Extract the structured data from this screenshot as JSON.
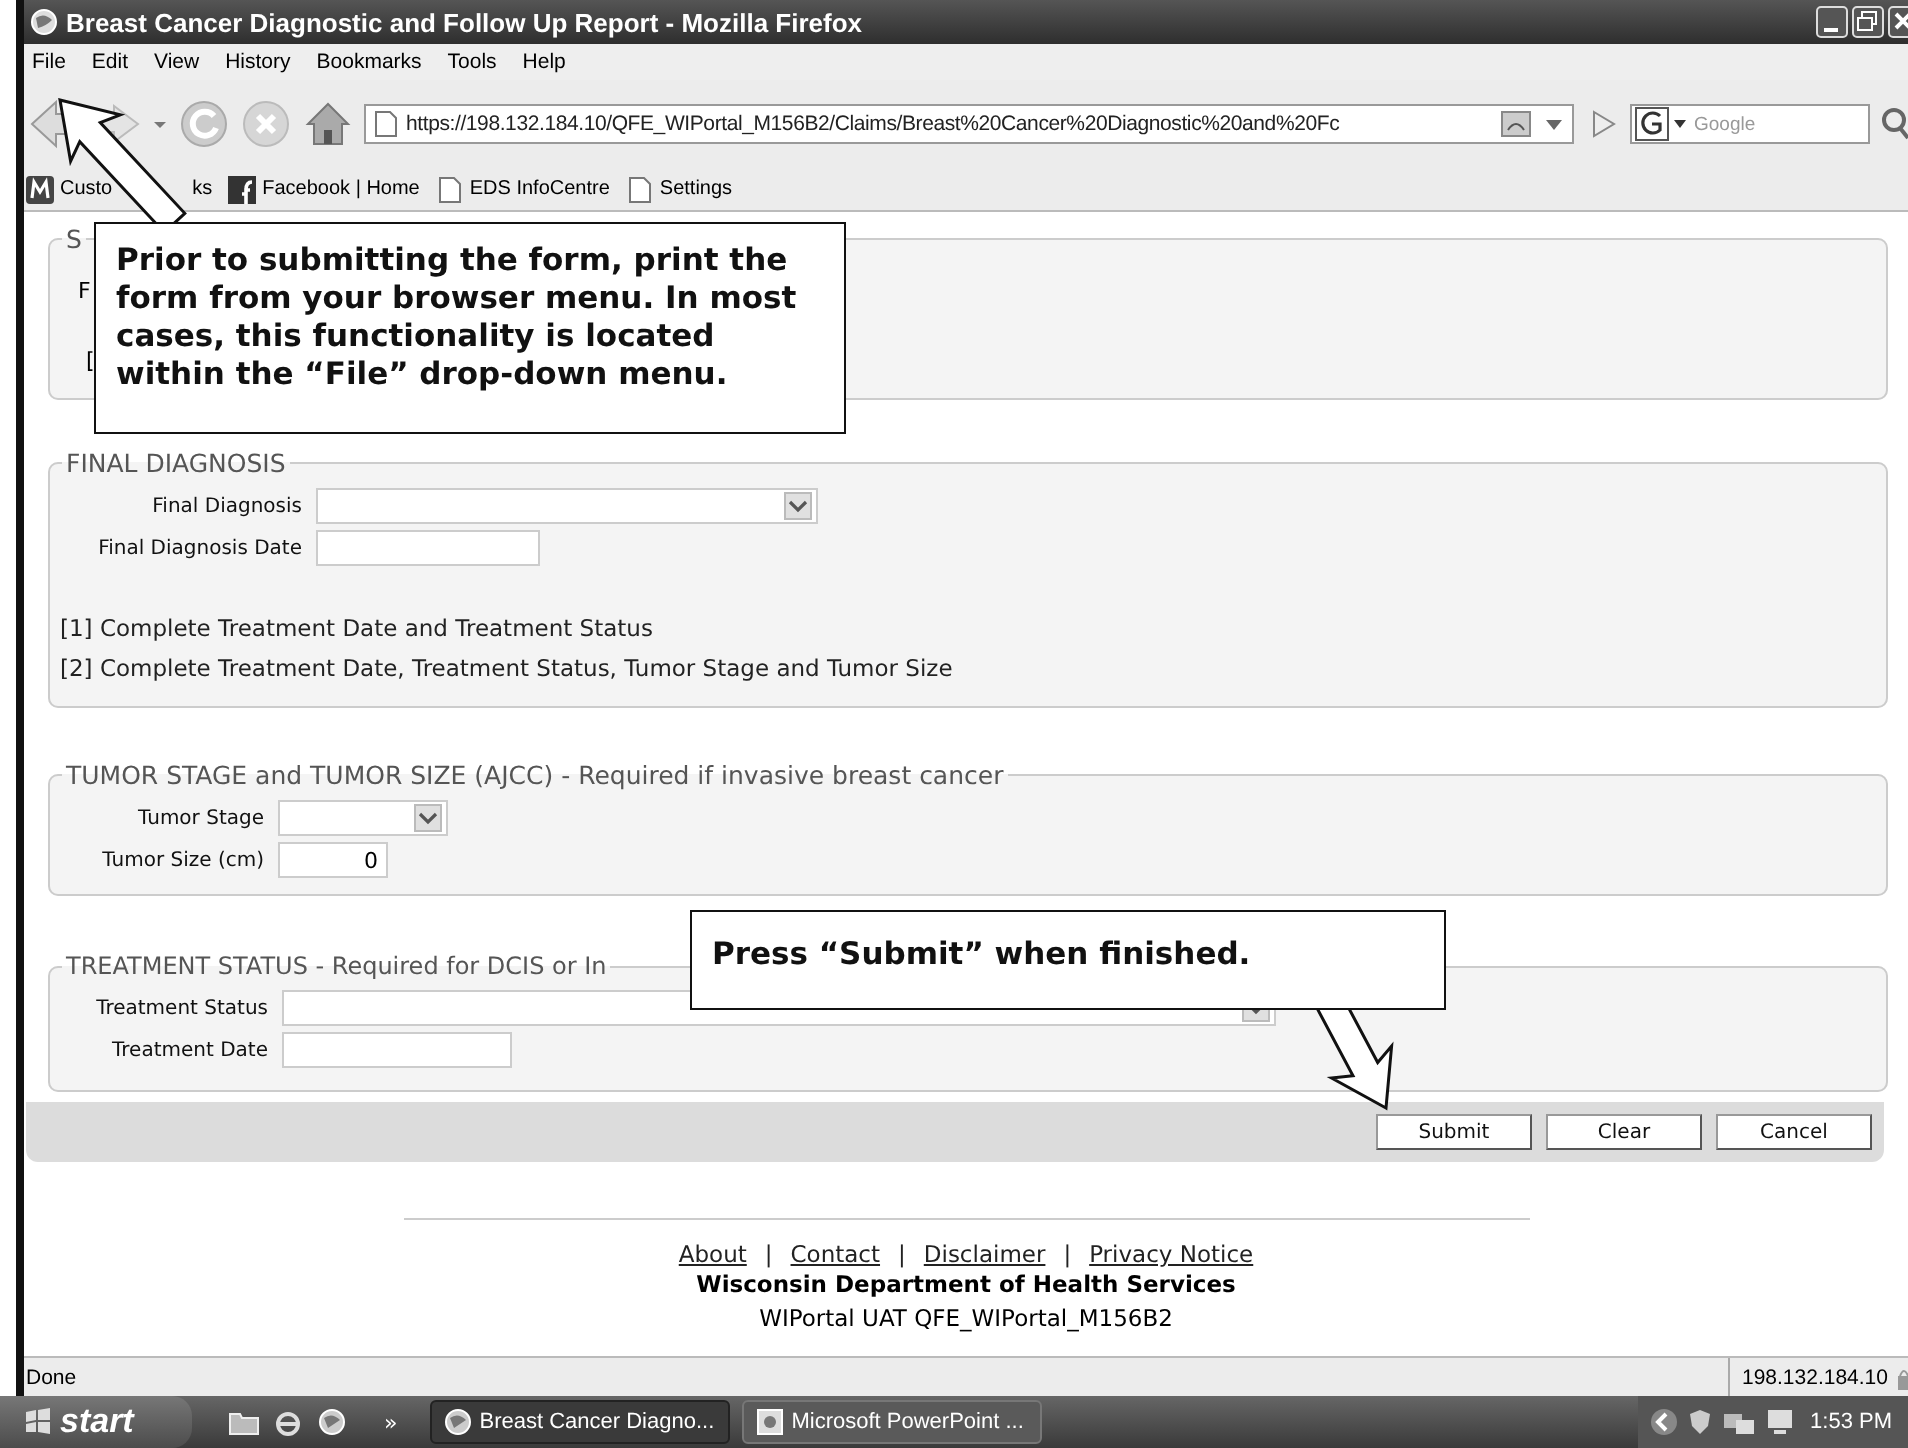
{
  "window": {
    "title": "Breast Cancer Diagnostic and Follow Up Report - Mozilla Firefox"
  },
  "menu": [
    "File",
    "Edit",
    "View",
    "History",
    "Bookmarks",
    "Tools",
    "Help"
  ],
  "address": {
    "value": "https://198.132.184.10/QFE_WIPortal_M156B2/Claims/Breast%20Cancer%20Diagnostic%20and%20Fc"
  },
  "search": {
    "placeholder": "Google"
  },
  "bookmarks": [
    {
      "kind": "custom",
      "label_start": "Custo",
      "label_end": "ks"
    },
    {
      "kind": "facebook",
      "label": "Facebook | Home"
    },
    {
      "kind": "page",
      "label": "EDS InfoCentre"
    },
    {
      "kind": "page",
      "label": "Settings"
    }
  ],
  "sections": [
    {
      "legend": "S",
      "rows": [
        {
          "kind": "fragment",
          "text": "F"
        },
        {
          "kind": "fragment",
          "text": "["
        }
      ]
    },
    {
      "legend": "FINAL DIAGNOSIS",
      "rows": [
        {
          "kind": "select",
          "label": "Final Diagnosis"
        },
        {
          "kind": "text",
          "label": "Final Diagnosis Date"
        },
        {
          "kind": "note",
          "text": "[1] Complete Treatment Date and Treatment Status"
        },
        {
          "kind": "note",
          "text": "[2] Complete Treatment Date, Treatment Status, Tumor Stage and Tumor Size"
        }
      ]
    },
    {
      "legend": "TUMOR STAGE and TUMOR SIZE (AJCC) - Required if invasive breast cancer",
      "rows": [
        {
          "kind": "select",
          "label": "Tumor Stage"
        },
        {
          "kind": "text",
          "label": "Tumor Size (cm)",
          "value": "0"
        }
      ]
    },
    {
      "legend": "TREATMENT STATUS - Required for DCIS or In",
      "rows": [
        {
          "kind": "select",
          "label": "Treatment Status"
        },
        {
          "kind": "text",
          "label": "Treatment Date"
        }
      ]
    }
  ],
  "buttons": [
    "Submit",
    "Clear",
    "Cancel"
  ],
  "callouts": [
    {
      "text": "Prior to submitting the form, print the form from your browser menu. In most cases, this functionality is located within the “File” drop-down menu."
    },
    {
      "text": "Press “Submit” when finished."
    }
  ],
  "footer": {
    "items": [
      {
        "kind": "link",
        "text": "About"
      },
      {
        "kind": "separator",
        "text": "|"
      },
      {
        "kind": "link",
        "text": "Contact"
      },
      {
        "kind": "separator",
        "text": "|"
      },
      {
        "kind": "link",
        "text": "Disclaimer"
      },
      {
        "kind": "separator",
        "text": "|"
      },
      {
        "kind": "link",
        "text": "Privacy Notice"
      }
    ],
    "organization": "Wisconsin Department of Health Services",
    "portal": "WIPortal UAT QFE_WIPortal_M156B2"
  },
  "status_bar": {
    "text": "Done",
    "host": "198.132.184.10"
  },
  "taskbar": {
    "start": "start",
    "more": "»",
    "tasks": [
      {
        "label": "Breast Cancer Diagno...",
        "selected": true
      },
      {
        "label": "Microsoft PowerPoint ...",
        "selected": false
      }
    ],
    "clock": "1:53 PM"
  }
}
